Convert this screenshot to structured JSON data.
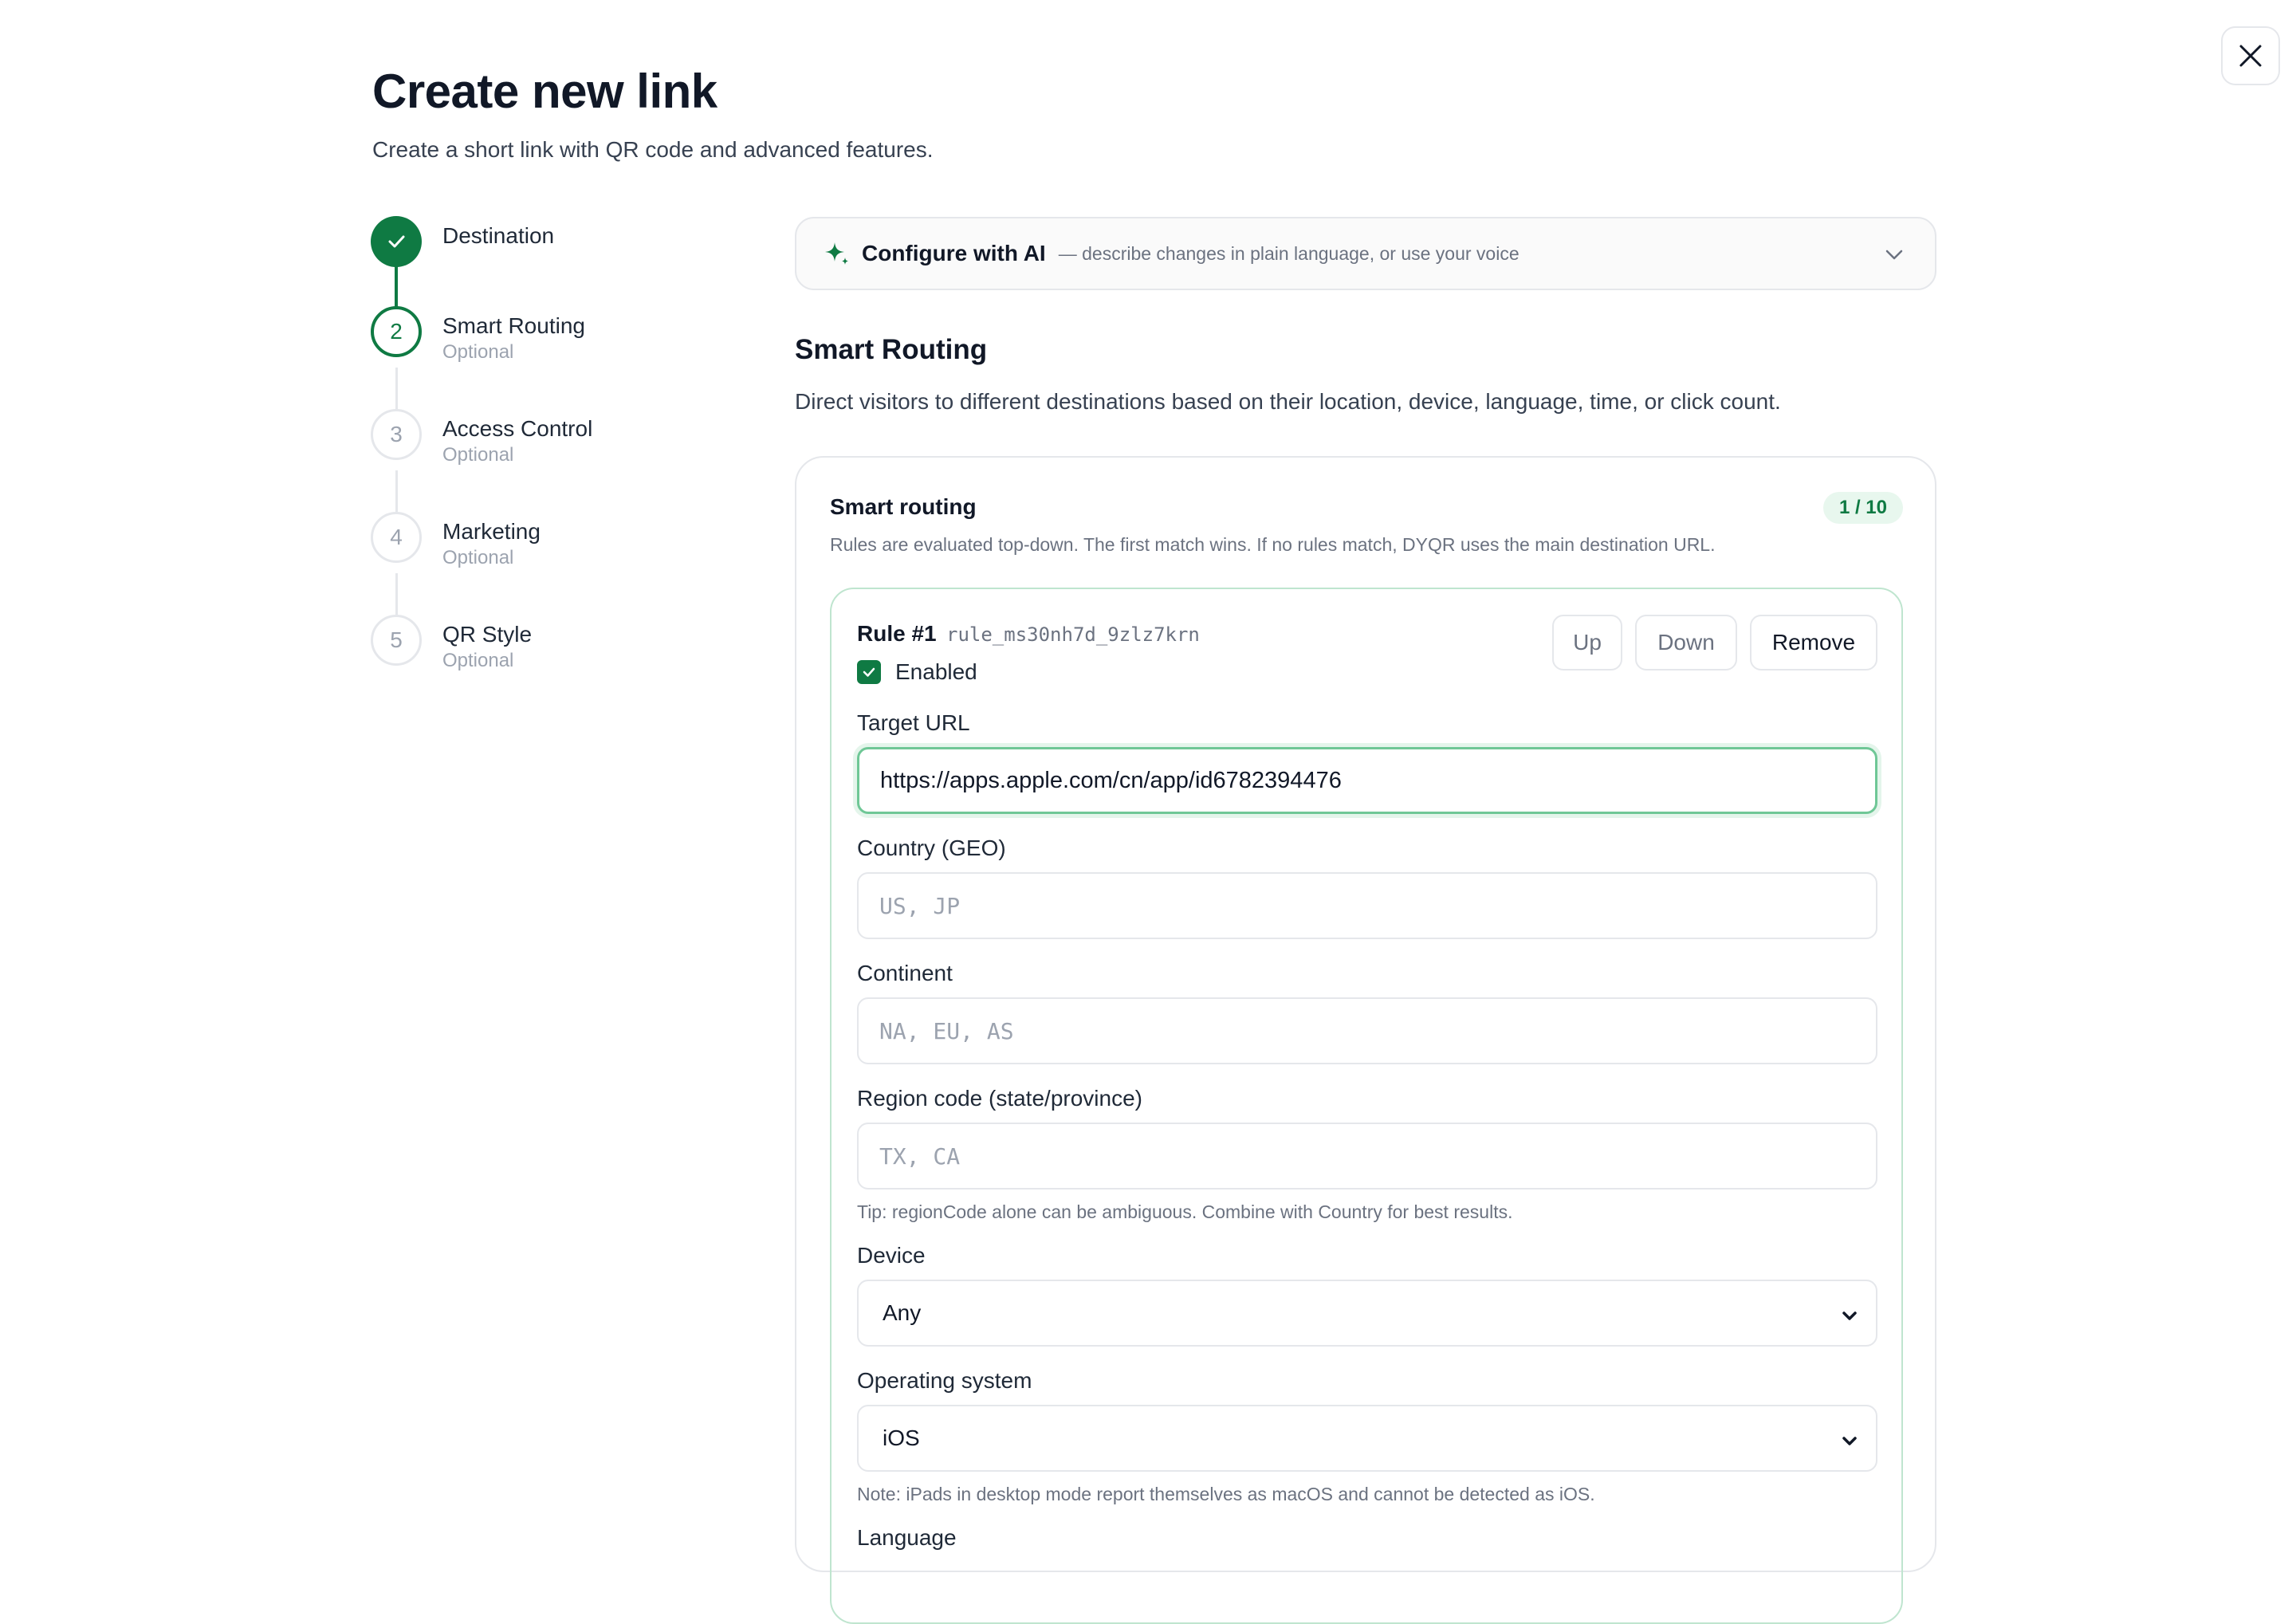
{
  "header": {
    "title": "Create new link",
    "subtitle": "Create a short link with QR code and advanced features."
  },
  "close_icon": "close-icon",
  "steps": [
    {
      "number": "",
      "label": "Destination",
      "sub": "",
      "state": "done",
      "icon": "check-icon"
    },
    {
      "number": "2",
      "label": "Smart Routing",
      "sub": "Optional",
      "state": "active"
    },
    {
      "number": "3",
      "label": "Access Control",
      "sub": "Optional",
      "state": "todo"
    },
    {
      "number": "4",
      "label": "Marketing",
      "sub": "Optional",
      "state": "todo"
    },
    {
      "number": "5",
      "label": "QR Style",
      "sub": "Optional",
      "state": "todo"
    }
  ],
  "ai_bar": {
    "icon": "sparkle-icon",
    "title": "Configure with AI",
    "description": "— describe changes in plain language, or use your voice"
  },
  "section": {
    "title": "Smart Routing",
    "description": "Direct visitors to different destinations based on their location, device, language, time, or click count."
  },
  "card": {
    "title": "Smart routing",
    "count": "1 / 10",
    "description": "Rules are evaluated top-down. The first match wins. If no rules match, DYQR uses the main destination URL."
  },
  "rule": {
    "title": "Rule #1",
    "id": "rule_ms30nh7d_9zlz7krn",
    "enabled_label": "Enabled",
    "enabled": true,
    "buttons": {
      "up": "Up",
      "down": "Down",
      "remove": "Remove"
    },
    "target_url": {
      "label": "Target URL",
      "value": "https://apps.apple.com/cn/app/id6782394476"
    },
    "country": {
      "label": "Country (GEO)",
      "placeholder": "US, JP"
    },
    "continent": {
      "label": "Continent",
      "placeholder": "NA, EU, AS"
    },
    "region": {
      "label": "Region code (state/province)",
      "placeholder": "TX, CA",
      "hint": "Tip: regionCode alone can be ambiguous. Combine with Country for best results."
    },
    "device": {
      "label": "Device",
      "value": "Any"
    },
    "os": {
      "label": "Operating system",
      "value": "iOS",
      "hint": "Note: iPads in desktop mode report themselves as macOS and cannot be detected as iOS."
    },
    "language": {
      "label": "Language"
    }
  },
  "colors": {
    "accent": "#0f7a43",
    "border": "#e5e7eb",
    "rule_border": "#bfe5cf"
  }
}
